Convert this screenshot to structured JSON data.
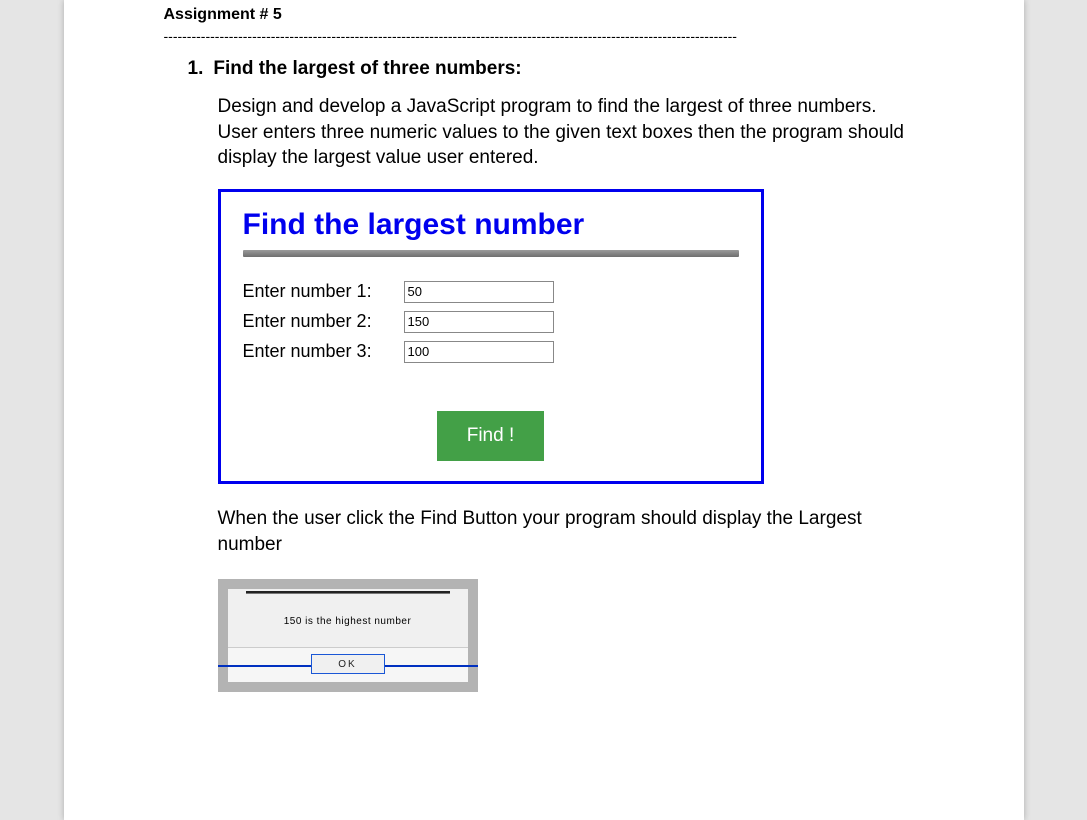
{
  "assignment_title": "Assignment # 5",
  "dashes": "---------------------------------------------------------------------------------------------------------------------------",
  "question": {
    "number": "1.",
    "title": "Find the largest of three numbers:",
    "description": "Design and develop a JavaScript program to find the largest of three numbers. User enters three numeric values to the given text boxes then the program should display the largest value user entered."
  },
  "app": {
    "heading": "Find the largest number",
    "fields": [
      {
        "label": "Enter number 1:",
        "value": "50"
      },
      {
        "label": "Enter number 2:",
        "value": "150"
      },
      {
        "label": "Enter number 3:",
        "value": "100"
      }
    ],
    "find_label": "Find !"
  },
  "after_text": "When the user click the Find Button your program should display the Largest number",
  "dialog": {
    "message": "150 is the highest number",
    "ok_label": "OK"
  }
}
